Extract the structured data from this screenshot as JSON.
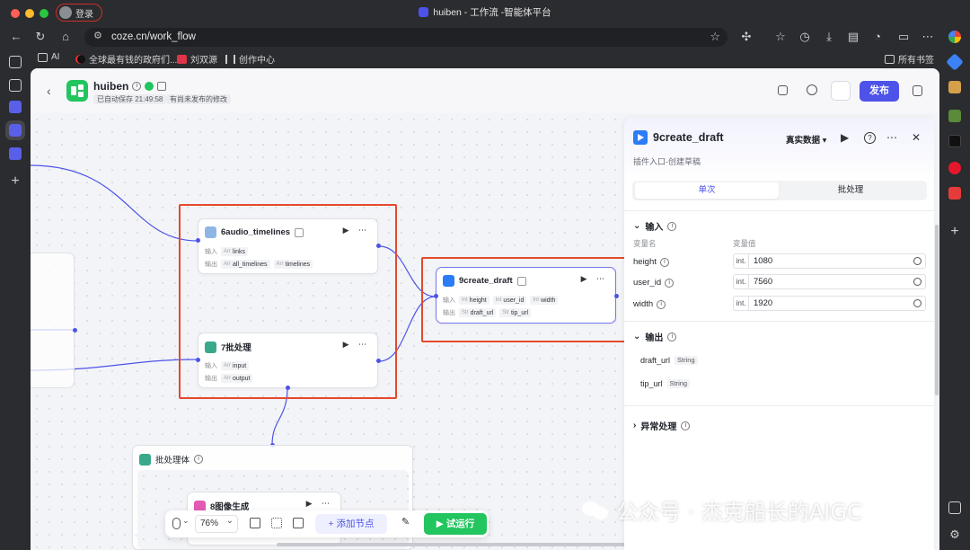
{
  "browser": {
    "profile_label": "登录",
    "window_title": "huiben - 工作流 -智能体平台",
    "url": "coze.cn/work_flow",
    "bookmarks": [
      {
        "label": "AI",
        "icon": "folder-icon"
      },
      {
        "label": "全球最有钱的政府们...",
        "icon": "tiktok-icon"
      },
      {
        "label": "刘双源",
        "icon": "red-app-icon"
      },
      {
        "label": "创作中心",
        "icon": "audio-wave-icon"
      }
    ],
    "all_bookmarks": "所有书签"
  },
  "header": {
    "app_name": "huiben",
    "autosave": "已自动保存 21:49:58",
    "unpublished": "有尚未发布的修改",
    "publish_label": "发布"
  },
  "nodes": {
    "audio": {
      "title": "6audio_timelines",
      "input_label": "输入",
      "inputs": [
        {
          "type": "Arr",
          "name": "links"
        }
      ],
      "output_label": "输出",
      "outputs": [
        {
          "type": "Arr",
          "name": "all_timelines"
        },
        {
          "type": "Arr",
          "name": "timelines"
        }
      ]
    },
    "batch": {
      "title": "7批处理",
      "input_label": "输入",
      "inputs": [
        {
          "type": "Arr",
          "name": "input"
        }
      ],
      "output_label": "输出",
      "outputs": [
        {
          "type": "Arr",
          "name": "output"
        }
      ]
    },
    "draft": {
      "title": "9create_draft",
      "input_label": "输入",
      "inputs": [
        {
          "type": "Int",
          "name": "height"
        },
        {
          "type": "Int",
          "name": "user_id"
        },
        {
          "type": "Int",
          "name": "width"
        }
      ],
      "output_label": "输出",
      "outputs": [
        {
          "type": "Str",
          "name": "draft_url"
        },
        {
          "type": "Str",
          "name": "tip_url"
        }
      ]
    },
    "batch_body": {
      "title": "批处理体"
    },
    "image": {
      "title": "8图像生成"
    }
  },
  "toolbar": {
    "zoom": "76%",
    "add_node": "添加节点",
    "test_run": "试运行"
  },
  "panel": {
    "title": "9create_draft",
    "data_mode": "真实数据",
    "subtitle": "插件入口-创建草稿",
    "tab_single": "单次",
    "tab_batch": "批处理",
    "input_section": "输入",
    "col_name": "变量名",
    "col_value": "变量值",
    "inputs": [
      {
        "name": "height",
        "type": "int.",
        "value": "1080"
      },
      {
        "name": "user_id",
        "type": "int.",
        "value": "7560"
      },
      {
        "name": "width",
        "type": "int.",
        "value": "1920"
      }
    ],
    "output_section": "输出",
    "outputs": [
      {
        "name": "draft_url",
        "type": "String"
      },
      {
        "name": "tip_url",
        "type": "String"
      }
    ],
    "exception_section": "异常处理"
  },
  "watermark": "公众号 · 杰克船长的AIGC",
  "colors": {
    "accent": "#4d53e8",
    "success": "#22c55e",
    "highlight_box": "#e5492d"
  }
}
